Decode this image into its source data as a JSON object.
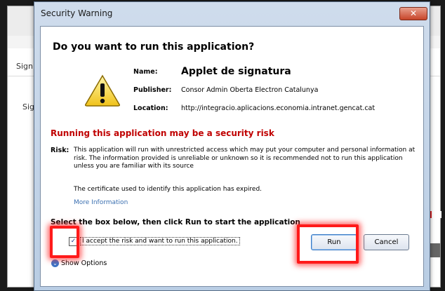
{
  "background_page": {
    "sign_label_1": "Sign",
    "sign_label_2": "Sig"
  },
  "dialog": {
    "title": "Security Warning",
    "close_label": "✕",
    "heading": "Do you want to run this application?",
    "name_label": "Name:",
    "name_value": "Applet de signatura",
    "publisher_label": "Publisher:",
    "publisher_value": "Consor Admin Oberta Electron Catalunya",
    "location_label": "Location:",
    "location_value": "http://integracio.aplicacions.economia.intranet.gencat.cat",
    "risk_title": "Running this application may be a security risk",
    "risk_label": "Risk:",
    "risk_text": "This application will run with unrestricted access which may put your computer and personal information at risk. The information provided is unreliable or unknown so it is recommended not to run this application unless you are familiar with its source",
    "cert_text": "The certificate used to identify this application has expired.",
    "more_info": "More Information",
    "select_text": "Select the box below, then click Run to start the application",
    "accept_text": "I accept the risk and want to run this application.",
    "checkbox_checked": true,
    "run_label": "Run",
    "cancel_label": "Cancel",
    "show_options": "Show Options"
  },
  "colors": {
    "risk_title": "#c00000",
    "highlight": "#ff1a1a",
    "link": "#3a6fb0"
  }
}
